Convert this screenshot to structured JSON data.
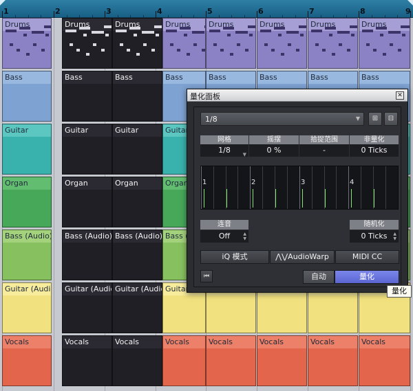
{
  "ruler": {
    "bars": [
      "1",
      "2",
      "3",
      "4",
      "5",
      "6",
      "7",
      "8",
      "9"
    ]
  },
  "colors": {
    "drums": "#8a82c4",
    "drums_bar": "#a59fd6",
    "bass": "#7ea2d2",
    "bass_bar": "#99b8e0",
    "guitar": "#39b2ad",
    "guitar_bar": "#5cc7c0",
    "organ": "#47a85a",
    "organ_bar": "#62bd70",
    "bass_audio": "#86c05f",
    "bass_audio_bar": "#a3d17c",
    "guitar_audio": "#f1e27f",
    "guitar_audio_bar": "#f7ec9c",
    "vocals": "#e3654c",
    "vocals_bar": "#ec8068",
    "accent": "#6a74e0"
  },
  "tracks": [
    {
      "key": "drums",
      "label": "Drums",
      "type": "midi"
    },
    {
      "key": "bass",
      "label": "Bass",
      "type": "midi"
    },
    {
      "key": "guitar",
      "label": "Guitar",
      "type": "midi"
    },
    {
      "key": "organ",
      "label": "Organ",
      "type": "midi"
    },
    {
      "key": "bass_audio",
      "label": "Bass (Audio)",
      "type": "audio"
    },
    {
      "key": "guitar_audio",
      "label": "Guitar (Audio)",
      "type": "audio"
    },
    {
      "key": "vocals",
      "label": "Vocals",
      "type": "audio"
    }
  ],
  "quantize_panel": {
    "title": "量化面板",
    "close_icon": "close-icon",
    "preset": {
      "value": "1/8"
    },
    "params": [
      {
        "header": "网格",
        "value": "1/8"
      },
      {
        "header": "摇摆",
        "value": "0 %"
      },
      {
        "header": "拾捉范围",
        "value": "-"
      },
      {
        "header": "非量化",
        "value": "0 Ticks"
      }
    ],
    "grid_labels": [
      "1",
      "2",
      "3",
      "4"
    ],
    "legato": {
      "header": "连音",
      "value": "Off"
    },
    "randomize": {
      "header": "随机化",
      "value": "0 Ticks"
    },
    "mode_buttons": [
      "iQ 模式",
      "AudioWarp",
      "MIDI CC"
    ],
    "auto_label": "自动",
    "apply_label": "量化",
    "tooltip": "量化"
  }
}
